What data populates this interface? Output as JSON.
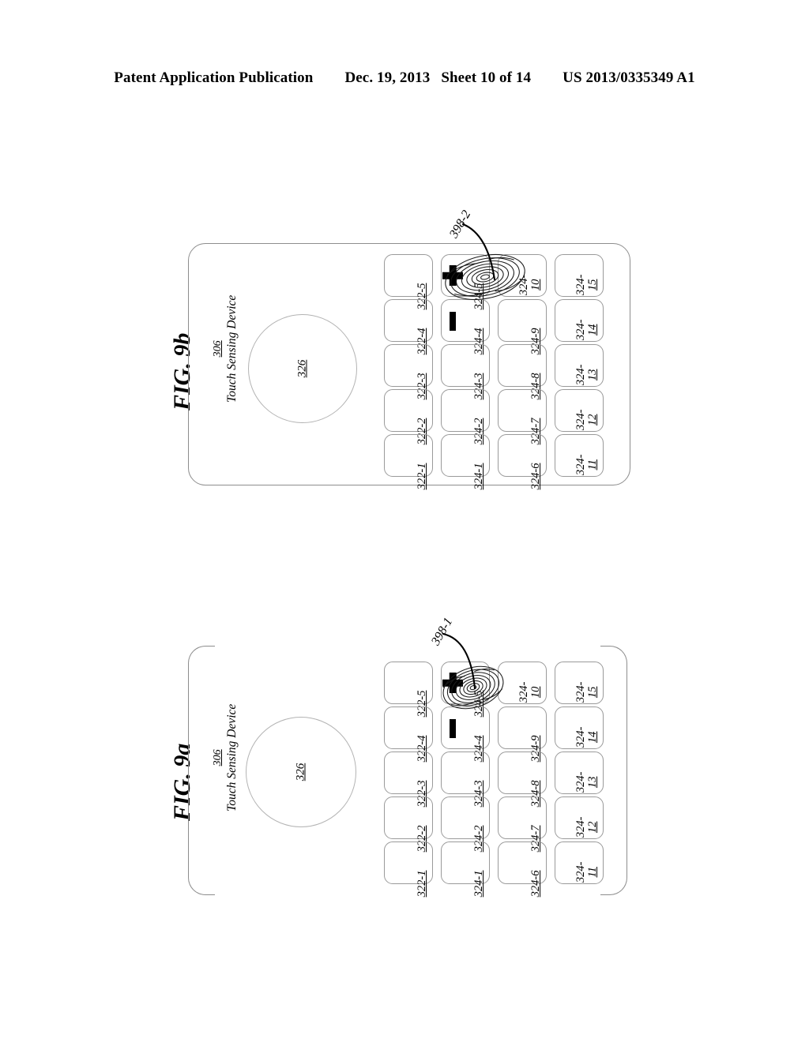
{
  "header": {
    "publication": "Patent Application Publication",
    "date": "Dec. 19, 2013",
    "sheet": "Sheet 10 of 14",
    "docnum": "US 2013/0335349 A1"
  },
  "figures": [
    {
      "id": "fig-9b",
      "title": "FIG. 9b",
      "device": {
        "ref": "306",
        "name": "Touch Sensing Device",
        "outline_style": "closed-rounded-rect"
      },
      "touch_region": {
        "ref": "326",
        "shape": "circle"
      },
      "callout": {
        "ref": "398-2",
        "points_to": "fingerprint-contact"
      },
      "contact": {
        "type": "fingerprint",
        "on_key": "324-5",
        "offset": "shifted-right-overlapping-324-10"
      },
      "columns": [
        {
          "name": "column-322",
          "keys": [
            {
              "ref": "322-5",
              "lines": [
                "322-5"
              ],
              "glyph": ""
            },
            {
              "ref": "322-4",
              "lines": [
                "322-4"
              ],
              "glyph": ""
            },
            {
              "ref": "322-3",
              "lines": [
                "322-3"
              ],
              "glyph": ""
            },
            {
              "ref": "322-2",
              "lines": [
                "322-2"
              ],
              "glyph": ""
            },
            {
              "ref": "322-1",
              "lines": [
                "322-1"
              ],
              "glyph": ""
            }
          ]
        },
        {
          "name": "column-324-a",
          "keys": [
            {
              "ref": "324-5",
              "lines": [
                "324-5"
              ],
              "glyph": "plus"
            },
            {
              "ref": "324-4",
              "lines": [
                "324-4"
              ],
              "glyph": "minus"
            },
            {
              "ref": "324-3",
              "lines": [
                "324-3"
              ],
              "glyph": ""
            },
            {
              "ref": "324-2",
              "lines": [
                "324-2"
              ],
              "glyph": ""
            },
            {
              "ref": "324-1",
              "lines": [
                "324-1"
              ],
              "glyph": ""
            }
          ]
        },
        {
          "name": "column-324-b",
          "keys": [
            {
              "ref": "324-10",
              "lines": [
                "324-",
                "10"
              ],
              "glyph": ""
            },
            {
              "ref": "324-9",
              "lines": [
                "324-9"
              ],
              "glyph": ""
            },
            {
              "ref": "324-8",
              "lines": [
                "324-8"
              ],
              "glyph": ""
            },
            {
              "ref": "324-7",
              "lines": [
                "324-7"
              ],
              "glyph": ""
            },
            {
              "ref": "324-6",
              "lines": [
                "324-6"
              ],
              "glyph": ""
            }
          ]
        },
        {
          "name": "column-324-c",
          "keys": [
            {
              "ref": "324-15",
              "lines": [
                "324-",
                "15"
              ],
              "glyph": ""
            },
            {
              "ref": "324-14",
              "lines": [
                "324-",
                "14"
              ],
              "glyph": ""
            },
            {
              "ref": "324-13",
              "lines": [
                "324-",
                "13"
              ],
              "glyph": ""
            },
            {
              "ref": "324-12",
              "lines": [
                "324-",
                "12"
              ],
              "glyph": ""
            },
            {
              "ref": "324-11",
              "lines": [
                "324-",
                "11"
              ],
              "glyph": ""
            }
          ]
        }
      ]
    },
    {
      "id": "fig-9a",
      "title": "FIG. 9a",
      "device": {
        "ref": "306",
        "name": "Touch Sensing Device",
        "outline_style": "side-brackets"
      },
      "touch_region": {
        "ref": "326",
        "shape": "circle"
      },
      "callout": {
        "ref": "398-1",
        "points_to": "fingerprint-contact"
      },
      "contact": {
        "type": "fingerprint",
        "on_key": "324-5",
        "offset": "centered-on-key"
      },
      "columns": [
        {
          "name": "column-322",
          "keys": [
            {
              "ref": "322-5",
              "lines": [
                "322-5"
              ],
              "glyph": ""
            },
            {
              "ref": "322-4",
              "lines": [
                "322-4"
              ],
              "glyph": ""
            },
            {
              "ref": "322-3",
              "lines": [
                "322-3"
              ],
              "glyph": ""
            },
            {
              "ref": "322-2",
              "lines": [
                "322-2"
              ],
              "glyph": ""
            },
            {
              "ref": "322-1",
              "lines": [
                "322-1"
              ],
              "glyph": ""
            }
          ]
        },
        {
          "name": "column-324-a",
          "keys": [
            {
              "ref": "324-5",
              "lines": [
                "324-5"
              ],
              "glyph": "plus"
            },
            {
              "ref": "324-4",
              "lines": [
                "324-4"
              ],
              "glyph": "minus"
            },
            {
              "ref": "324-3",
              "lines": [
                "324-3"
              ],
              "glyph": ""
            },
            {
              "ref": "324-2",
              "lines": [
                "324-2"
              ],
              "glyph": ""
            },
            {
              "ref": "324-1",
              "lines": [
                "324-1"
              ],
              "glyph": ""
            }
          ]
        },
        {
          "name": "column-324-b",
          "keys": [
            {
              "ref": "324-10",
              "lines": [
                "324-",
                "10"
              ],
              "glyph": ""
            },
            {
              "ref": "324-9",
              "lines": [
                "324-9"
              ],
              "glyph": ""
            },
            {
              "ref": "324-8",
              "lines": [
                "324-8"
              ],
              "glyph": ""
            },
            {
              "ref": "324-7",
              "lines": [
                "324-7"
              ],
              "glyph": ""
            },
            {
              "ref": "324-6",
              "lines": [
                "324-6"
              ],
              "glyph": ""
            }
          ]
        },
        {
          "name": "column-324-c",
          "keys": [
            {
              "ref": "324-15",
              "lines": [
                "324-",
                "15"
              ],
              "glyph": ""
            },
            {
              "ref": "324-14",
              "lines": [
                "324-",
                "14"
              ],
              "glyph": ""
            },
            {
              "ref": "324-13",
              "lines": [
                "324-",
                "13"
              ],
              "glyph": ""
            },
            {
              "ref": "324-12",
              "lines": [
                "324-",
                "12"
              ],
              "glyph": ""
            },
            {
              "ref": "324-11",
              "lines": [
                "324-",
                "11"
              ],
              "glyph": ""
            }
          ]
        }
      ]
    }
  ],
  "colors": {
    "ink": "#000000",
    "outline": "#8d8d8d",
    "key_outline": "#9a9a9a",
    "circle_outline": "#b3b3b3",
    "background": "#ffffff"
  }
}
